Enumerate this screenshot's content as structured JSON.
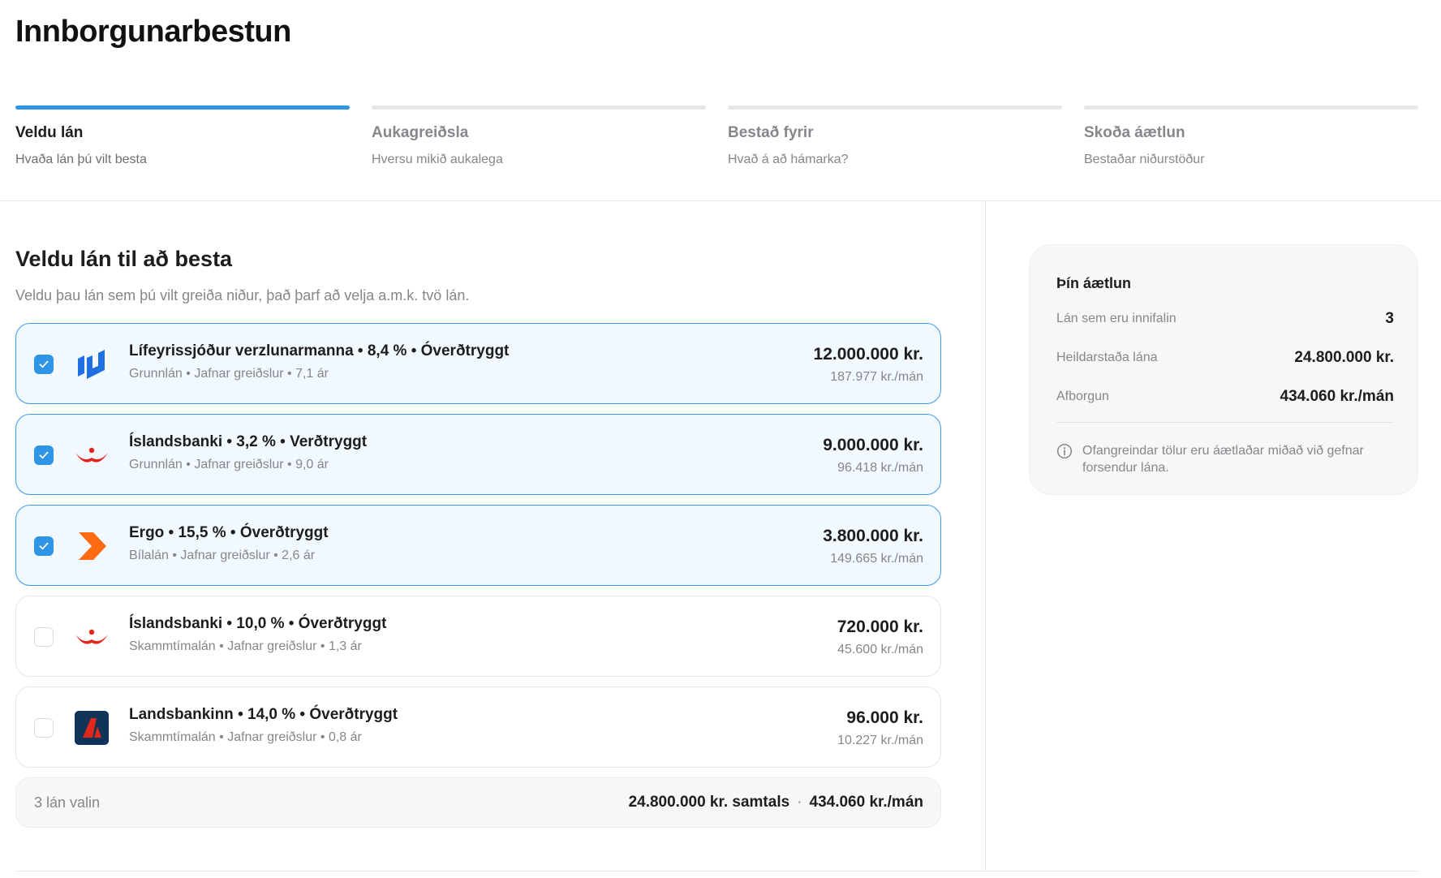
{
  "page": {
    "title": "Innborgunarbestun"
  },
  "steps": [
    {
      "title": "Veldu lán",
      "subtitle": "Hvaða lán þú vilt besta",
      "active": true
    },
    {
      "title": "Aukagreiðsla",
      "subtitle": "Hversu mikið aukalega",
      "active": false
    },
    {
      "title": "Bestað fyrir",
      "subtitle": "Hvað á að hámarka?",
      "active": false
    },
    {
      "title": "Skoða áætlun",
      "subtitle": "Bestaðar niðurstöður",
      "active": false
    }
  ],
  "main": {
    "title": "Veldu lán til að besta",
    "subtitle": "Veldu þau lán sem þú vilt greiða niður, það þarf að velja a.m.k. tvö lán."
  },
  "loans": [
    {
      "name": "Lífeyrissjóður verzlunarmanna • 8,4 % • Óverðtryggt",
      "meta": "Grunnlán • Jafnar greiðslur • 7,1 ár",
      "amount": "12.000.000 kr.",
      "monthly": "187.977 kr./mán",
      "selected": true,
      "logo": "lv-logo-icon"
    },
    {
      "name": "Íslandsbanki • 3,2 % • Verðtryggt",
      "meta": "Grunnlán • Jafnar greiðslur • 9,0 ár",
      "amount": "9.000.000 kr.",
      "monthly": "96.418 kr./mán",
      "selected": true,
      "logo": "islandsbanki-logo-icon"
    },
    {
      "name": "Ergo • 15,5 % • Óverðtryggt",
      "meta": "Bílalán • Jafnar greiðslur • 2,6 ár",
      "amount": "3.800.000 kr.",
      "monthly": "149.665 kr./mán",
      "selected": true,
      "logo": "ergo-logo-icon"
    },
    {
      "name": "Íslandsbanki • 10,0 % • Óverðtryggt",
      "meta": "Skammtímalán • Jafnar greiðslur • 1,3 ár",
      "amount": "720.000 kr.",
      "monthly": "45.600 kr./mán",
      "selected": false,
      "logo": "islandsbanki-logo-icon"
    },
    {
      "name": "Landsbankinn • 14,0 % • Óverðtryggt",
      "meta": "Skammtímalán • Jafnar greiðslur • 0,8 ár",
      "amount": "96.000 kr.",
      "monthly": "10.227 kr./mán",
      "selected": false,
      "logo": "landsbankinn-logo-icon"
    }
  ],
  "summary": {
    "count": "3 lán valin",
    "total": "24.800.000 kr. samtals",
    "separator": "·",
    "monthly": "434.060 kr./mán"
  },
  "plan": {
    "title": "Þín áætlun",
    "rows": [
      {
        "label": "Lán sem eru innifalin",
        "value": "3"
      },
      {
        "label": "Heildarstaða lána",
        "value": "24.800.000 kr."
      },
      {
        "label": "Afborgun",
        "value": "434.060 kr./mán"
      }
    ],
    "note": "Ofangreindar tölur eru áætlaðar miðað við gefnar forsendur lána.",
    "note_icon": "info-icon"
  },
  "colors": {
    "accent": "#2f96e6",
    "selected_bg": "#f1f8fe",
    "selected_border": "#3c9ae8",
    "lv_blue": "#1f6fe0",
    "islandsbanki_red": "#e1261c",
    "ergo_orange": "#ff6a13",
    "landsbankinn_navy": "#0f3457"
  }
}
